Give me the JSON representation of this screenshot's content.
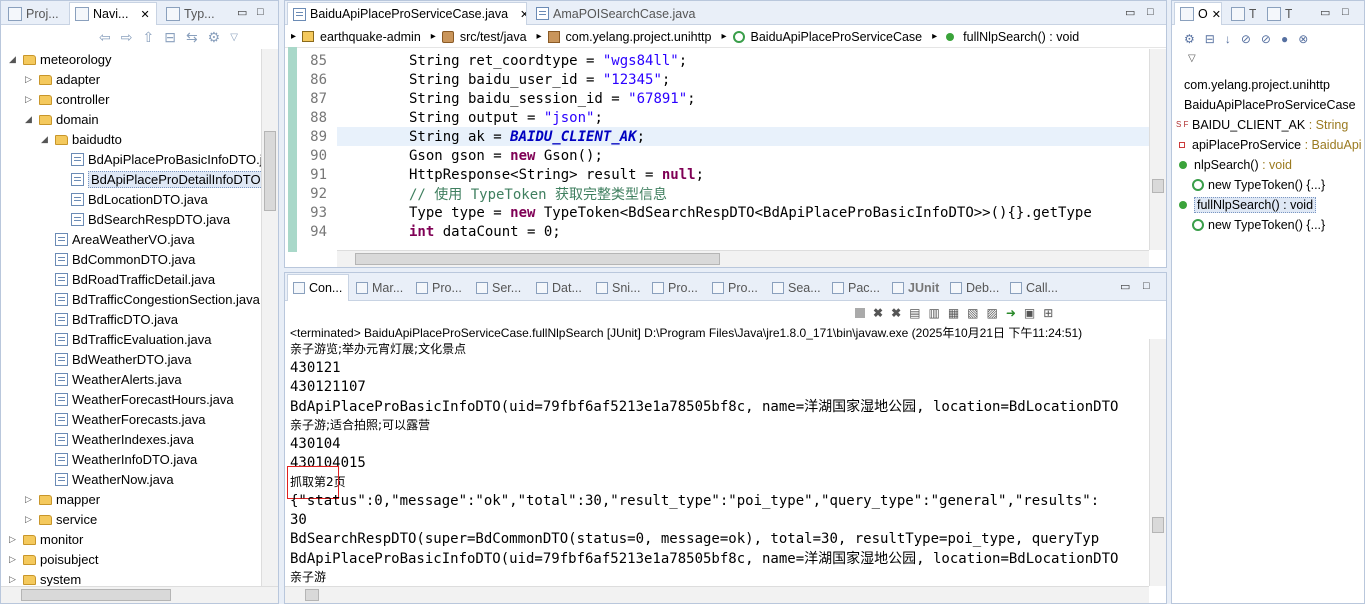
{
  "left_panel": {
    "tabs": [
      {
        "label": "Proj..."
      },
      {
        "label": "Navi..."
      },
      {
        "label": "Typ..."
      }
    ],
    "tree": [
      {
        "label": "meteorology",
        "indent": 0,
        "icon": "folder-icon",
        "expanded": true
      },
      {
        "label": "adapter",
        "indent": 1,
        "icon": "folder-icon",
        "expanded": false
      },
      {
        "label": "controller",
        "indent": 1,
        "icon": "folder-icon",
        "expanded": false
      },
      {
        "label": "domain",
        "indent": 1,
        "icon": "folder-icon",
        "expanded": true
      },
      {
        "label": "baidudto",
        "indent": 2,
        "icon": "folder-icon",
        "expanded": true
      },
      {
        "label": "BdApiPlaceProBasicInfoDTO.j",
        "indent": 3,
        "icon": "java-file-icon"
      },
      {
        "label": "BdApiPlaceProDetailInfoDTO.",
        "indent": 3,
        "icon": "java-file-icon",
        "selected": true
      },
      {
        "label": "BdLocationDTO.java",
        "indent": 3,
        "icon": "java-file-icon"
      },
      {
        "label": "BdSearchRespDTO.java",
        "indent": 3,
        "icon": "java-file-icon"
      },
      {
        "label": "AreaWeatherVO.java",
        "indent": 2,
        "icon": "java-file-icon"
      },
      {
        "label": "BdCommonDTO.java",
        "indent": 2,
        "icon": "java-file-icon"
      },
      {
        "label": "BdRoadTrafficDetail.java",
        "indent": 2,
        "icon": "java-file-icon"
      },
      {
        "label": "BdTrafficCongestionSection.java",
        "indent": 2,
        "icon": "java-file-icon"
      },
      {
        "label": "BdTrafficDTO.java",
        "indent": 2,
        "icon": "java-file-icon"
      },
      {
        "label": "BdTrafficEvaluation.java",
        "indent": 2,
        "icon": "java-file-icon"
      },
      {
        "label": "BdWeatherDTO.java",
        "indent": 2,
        "icon": "java-file-icon"
      },
      {
        "label": "WeatherAlerts.java",
        "indent": 2,
        "icon": "java-file-icon"
      },
      {
        "label": "WeatherForecastHours.java",
        "indent": 2,
        "icon": "java-file-icon"
      },
      {
        "label": "WeatherForecasts.java",
        "indent": 2,
        "icon": "java-file-icon"
      },
      {
        "label": "WeatherIndexes.java",
        "indent": 2,
        "icon": "java-file-icon"
      },
      {
        "label": "WeatherInfoDTO.java",
        "indent": 2,
        "icon": "java-file-icon"
      },
      {
        "label": "WeatherNow.java",
        "indent": 2,
        "icon": "java-file-icon"
      },
      {
        "label": "mapper",
        "indent": 1,
        "icon": "folder-icon",
        "expanded": false
      },
      {
        "label": "service",
        "indent": 1,
        "icon": "folder-icon",
        "expanded": false
      },
      {
        "label": "monitor",
        "indent": 0,
        "icon": "folder-icon",
        "expanded": false
      },
      {
        "label": "poisubject",
        "indent": 0,
        "icon": "folder-icon",
        "expanded": false
      },
      {
        "label": "system",
        "indent": 0,
        "icon": "folder-icon",
        "expanded": false
      }
    ]
  },
  "editor": {
    "tabs": [
      {
        "label": "BaiduApiPlaceProServiceCase.java"
      },
      {
        "label": "AmaPOISearchCase.java"
      }
    ],
    "breadcrumb": [
      {
        "label": "earthquake-admin",
        "icon": "project-icon"
      },
      {
        "label": "src/test/java",
        "icon": "source-folder-icon"
      },
      {
        "label": "com.yelang.project.unihttp",
        "icon": "package-icon"
      },
      {
        "label": "BaiduApiPlaceProServiceCase",
        "icon": "class-icon"
      },
      {
        "label": "fullNlpSearch() : void",
        "icon": "method-icon"
      }
    ],
    "lines": [
      {
        "num": "85",
        "parts": [
          [
            "",
            "String ret_coordtype = "
          ],
          [
            "str",
            "\"wgs84ll\""
          ],
          [
            "",
            ";"
          ]
        ]
      },
      {
        "num": "86",
        "parts": [
          [
            "",
            "String baidu_user_id = "
          ],
          [
            "str",
            "\"12345\""
          ],
          [
            "",
            ";"
          ]
        ]
      },
      {
        "num": "87",
        "parts": [
          [
            "",
            "String baidu_session_id = "
          ],
          [
            "str",
            "\"67891\""
          ],
          [
            "",
            ";"
          ]
        ]
      },
      {
        "num": "88",
        "parts": [
          [
            "",
            "String output = "
          ],
          [
            "str",
            "\"json\""
          ],
          [
            "",
            ";"
          ]
        ]
      },
      {
        "num": "89",
        "parts": [
          [
            "",
            "String ak = "
          ],
          [
            "cst",
            "BAIDU_CLIENT_AK"
          ],
          [
            "",
            ";"
          ]
        ],
        "highlight": true
      },
      {
        "num": "90",
        "parts": [
          [
            "",
            "Gson gson = "
          ],
          [
            "kw",
            "new"
          ],
          [
            "",
            " Gson();"
          ]
        ]
      },
      {
        "num": "91",
        "parts": [
          [
            "",
            "HttpResponse<String> result = "
          ],
          [
            "kw",
            "null"
          ],
          [
            "",
            ";"
          ]
        ]
      },
      {
        "num": "92",
        "parts": [
          [
            "cmt",
            "// 使用 TypeToken 获取完整类型信息"
          ]
        ]
      },
      {
        "num": "93",
        "parts": [
          [
            "",
            "Type type = "
          ],
          [
            "kw",
            "new"
          ],
          [
            "",
            " TypeToken<BdSearchRespDTO<BdApiPlaceProBasicInfoDTO>>(){}.getType"
          ]
        ]
      },
      {
        "num": "94",
        "parts": [
          [
            "kw",
            "int"
          ],
          [
            "",
            " dataCount = 0;"
          ]
        ]
      }
    ]
  },
  "console": {
    "tabs": [
      {
        "label": "Con..."
      },
      {
        "label": "Mar..."
      },
      {
        "label": "Pro..."
      },
      {
        "label": "Ser..."
      },
      {
        "label": "Dat..."
      },
      {
        "label": "Sni..."
      },
      {
        "label": "Pro..."
      },
      {
        "label": "Pro..."
      },
      {
        "label": "Sea..."
      },
      {
        "label": "Pac..."
      },
      {
        "label": "JUnit"
      },
      {
        "label": "Deb..."
      },
      {
        "label": "Call..."
      }
    ],
    "status": "<terminated> BaiduApiPlaceProServiceCase.fullNlpSearch [JUnit] D:\\Program Files\\Java\\jre1.8.0_171\\bin\\javaw.exe (2025年10月21日 下午11:24:51)",
    "lines": [
      {
        "text": "亲子游览;举办元宵灯展;文化景点",
        "cjk": true
      },
      {
        "text": "430121"
      },
      {
        "text": "430121107"
      },
      {
        "text": "BdApiPlaceProBasicInfoDTO(uid=79fbf6af5213e1a78505bf8c, name=洋湖国家湿地公园, location=BdLocationDTO"
      },
      {
        "text": "亲子游;适合拍照;可以露营",
        "cjk": true
      },
      {
        "text": "430104"
      },
      {
        "text": "430104015"
      },
      {
        "text": "抓取第2页",
        "cjk": true,
        "boxed": true
      },
      {
        "text": "{\"status\":0,\"message\":\"ok\",\"total\":30,\"result_type\":\"poi_type\",\"query_type\":\"general\",\"results\":"
      },
      {
        "text": "30"
      },
      {
        "text": "BdSearchRespDTO(super=BdCommonDTO(status=0, message=ok), total=30, resultType=poi_type, queryTyp"
      },
      {
        "text": "BdApiPlaceProBasicInfoDTO(uid=79fbf6af5213e1a78505bf8c, name=洋湖国家湿地公园, location=BdLocationDTO"
      },
      {
        "text": "亲子游",
        "cjk": true
      }
    ]
  },
  "outline": {
    "tabs": [
      {
        "label": "O"
      },
      {
        "label": "T"
      },
      {
        "label": "T"
      }
    ],
    "items": [
      {
        "label": "com.yelang.project.unihttp",
        "icon": "package-icon",
        "indent": 0
      },
      {
        "label": "BaiduApiPlaceProServiceCase",
        "icon": "class-icon",
        "indent": 0
      },
      {
        "label": "BAIDU_CLIENT_AK",
        "type": " : String",
        "icon": "static-final-field-icon",
        "indent": 0
      },
      {
        "label": "apiPlaceProService",
        "type": " : BaiduApi",
        "icon": "private-field-icon",
        "indent": 0
      },
      {
        "label": "nlpSearch()",
        "type": " : void",
        "icon": "public-method-icon",
        "indent": 0
      },
      {
        "label": "new TypeToken() {...}",
        "icon": "anonymous-class-icon",
        "indent": 1
      },
      {
        "label": "fullNlpSearch() : void",
        "icon": "public-method-icon",
        "indent": 0,
        "selected": true
      },
      {
        "label": "new TypeToken() {...}",
        "icon": "anonymous-class-icon",
        "indent": 1
      }
    ]
  }
}
